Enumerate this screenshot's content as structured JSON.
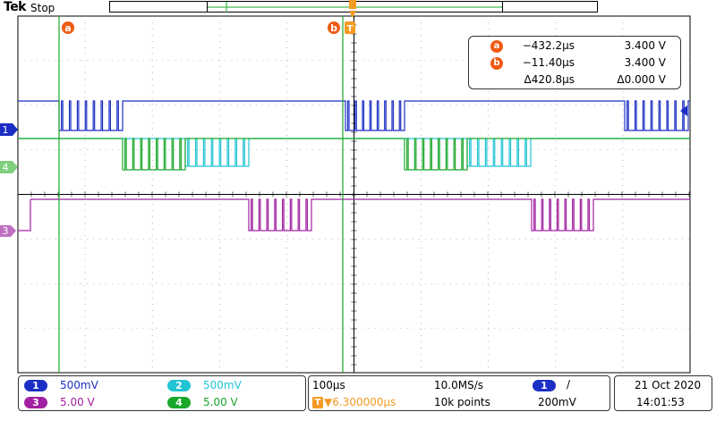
{
  "header": {
    "brand": "Tek",
    "acq_status": "Stop"
  },
  "markers": {
    "cursor_a": "a",
    "cursor_b": "b",
    "trigger": "T"
  },
  "readout": {
    "rows": [
      {
        "badge": "a",
        "time": "−432.2µs",
        "value": "3.400 V"
      },
      {
        "badge": "b",
        "time": "−11.40µs",
        "value": "3.400 V"
      },
      {
        "badge": "",
        "time": "Δ420.8µs",
        "value": "Δ0.000 V"
      }
    ]
  },
  "channels": {
    "ch1": {
      "num": "1",
      "scale": "500mV",
      "color": "#1c2fc4"
    },
    "ch2": {
      "num": "2",
      "scale": "500mV",
      "color": "#22c4d4"
    },
    "ch3": {
      "num": "3",
      "scale": "5.00 V",
      "color": "#a020a0"
    },
    "ch4": {
      "num": "4",
      "scale": "5.00 V",
      "color": "#1aa82a"
    }
  },
  "timebase": {
    "time_per_div": "100µs",
    "sample_rate": "10.0MS/s",
    "trigger_pos": "▼6.300000µs",
    "record_length": "10k points"
  },
  "trigger": {
    "source": "1",
    "slope": "/",
    "level": "200mV"
  },
  "datetime": {
    "date": "21 Oct  2020",
    "time": "14:01:53"
  },
  "ground_markers": {
    "ch1": "1",
    "ch4": "4",
    "ch3": "3"
  },
  "colors": {
    "cursor": "#1aa82a",
    "trigger": "#f59a23",
    "badge": "#f05a14"
  }
}
